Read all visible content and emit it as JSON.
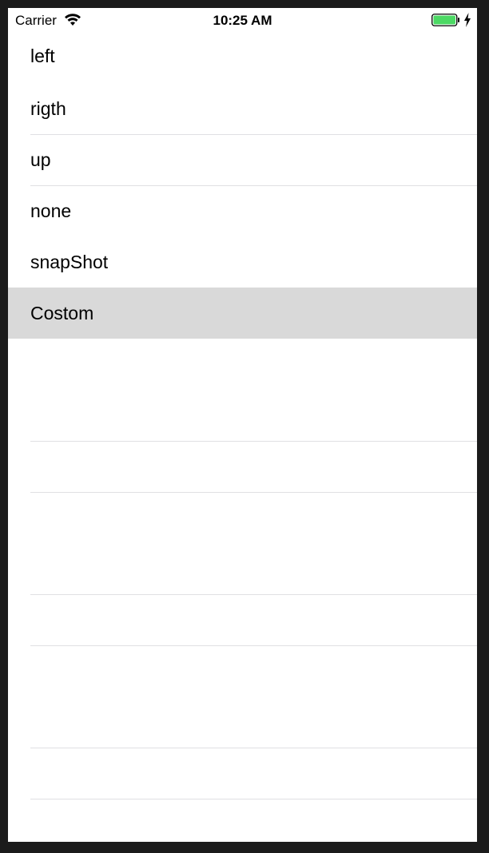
{
  "status_bar": {
    "carrier": "Carrier",
    "time": "10:25 AM",
    "wifi_icon": "wifi-icon",
    "battery_icon": "battery-charging-icon",
    "battery_color": "#4cd964"
  },
  "table": {
    "rows": [
      {
        "label": "left"
      },
      {
        "label": "rigth"
      },
      {
        "label": "up"
      },
      {
        "label": "none"
      },
      {
        "label": "snapShot"
      },
      {
        "label": "Costom",
        "selected": true
      }
    ],
    "selected_color": "#d9d9d9",
    "separator_color": "#e0e0e3"
  }
}
